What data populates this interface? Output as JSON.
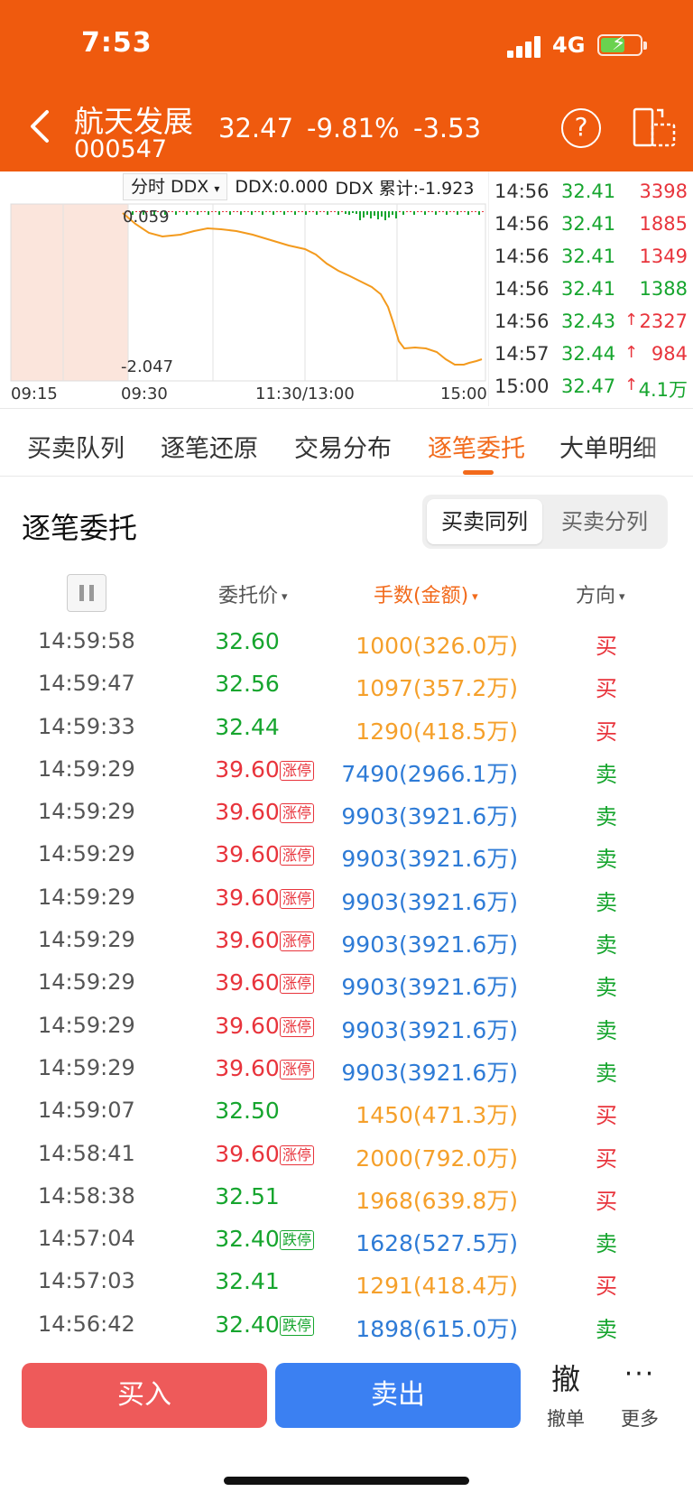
{
  "status_bar": {
    "time": "7:53",
    "network": "4G",
    "battery_bolt": "⚡"
  },
  "header": {
    "name": "航天发展",
    "code": "000547",
    "price": "32.47",
    "change_pct": "-9.81%",
    "change": "-3.53",
    "help_icon": "?"
  },
  "chart": {
    "indicator_select": "分时 DDX",
    "caret": "▾",
    "ddx_value": "DDX:0.000",
    "ddx_cumulative": "DDX 累计:-1.923",
    "top_value": "0.059",
    "bottom_value": "-2.047",
    "x_labels": [
      "09:15",
      "09:30",
      "11:30/13:00",
      "15:00"
    ],
    "line_color": "#f39a1d",
    "premarket_shade": "#fbe5dc"
  },
  "ticks": [
    {
      "time": "14:56",
      "price": "32.41",
      "arrow": "",
      "volume": "3398",
      "price_color": "green",
      "vol_color": "red"
    },
    {
      "time": "14:56",
      "price": "32.41",
      "arrow": "",
      "volume": "1885",
      "price_color": "green",
      "vol_color": "red"
    },
    {
      "time": "14:56",
      "price": "32.41",
      "arrow": "",
      "volume": "1349",
      "price_color": "green",
      "vol_color": "red"
    },
    {
      "time": "14:56",
      "price": "32.41",
      "arrow": "",
      "volume": "1388",
      "price_color": "green",
      "vol_color": "green"
    },
    {
      "time": "14:56",
      "price": "32.43",
      "arrow": "↑",
      "volume": "2327",
      "price_color": "green",
      "vol_color": "red"
    },
    {
      "time": "14:57",
      "price": "32.44",
      "arrow": "↑",
      "volume": "984",
      "price_color": "green",
      "vol_color": "red"
    },
    {
      "time": "15:00",
      "price": "32.47",
      "arrow": "↑",
      "volume": "4.1万",
      "price_color": "green",
      "vol_color": "green"
    }
  ],
  "tabs": [
    {
      "label": "买卖队列",
      "active": false
    },
    {
      "label": "逐笔还原",
      "active": false
    },
    {
      "label": "交易分布",
      "active": false
    },
    {
      "label": "逐笔委托",
      "active": true
    },
    {
      "label": "大单明细",
      "active": false
    }
  ],
  "section": {
    "title": "逐笔委托",
    "segments": [
      {
        "label": "买卖同列",
        "on": true
      },
      {
        "label": "买卖分列",
        "on": false
      }
    ]
  },
  "columns": {
    "price": "委托价",
    "volume": "手数(金额)",
    "direction": "方向",
    "caret": "▾"
  },
  "orders": [
    {
      "time": "14:59:58",
      "price": "32.60",
      "badge": "",
      "volume": "1000(326.0万)",
      "direction": "买",
      "price_color": "green",
      "vol_color": "orange",
      "dir_color": "red"
    },
    {
      "time": "14:59:47",
      "price": "32.56",
      "badge": "",
      "volume": "1097(357.2万)",
      "direction": "买",
      "price_color": "green",
      "vol_color": "orange",
      "dir_color": "red"
    },
    {
      "time": "14:59:33",
      "price": "32.44",
      "badge": "",
      "volume": "1290(418.5万)",
      "direction": "买",
      "price_color": "green",
      "vol_color": "orange",
      "dir_color": "red"
    },
    {
      "time": "14:59:29",
      "price": "39.60",
      "badge": "涨停",
      "badge_type": "up",
      "volume": "7490(2966.1万)",
      "direction": "卖",
      "price_color": "red",
      "vol_color": "blue",
      "dir_color": "green"
    },
    {
      "time": "14:59:29",
      "price": "39.60",
      "badge": "涨停",
      "badge_type": "up",
      "volume": "9903(3921.6万)",
      "direction": "卖",
      "price_color": "red",
      "vol_color": "blue",
      "dir_color": "green"
    },
    {
      "time": "14:59:29",
      "price": "39.60",
      "badge": "涨停",
      "badge_type": "up",
      "volume": "9903(3921.6万)",
      "direction": "卖",
      "price_color": "red",
      "vol_color": "blue",
      "dir_color": "green"
    },
    {
      "time": "14:59:29",
      "price": "39.60",
      "badge": "涨停",
      "badge_type": "up",
      "volume": "9903(3921.6万)",
      "direction": "卖",
      "price_color": "red",
      "vol_color": "blue",
      "dir_color": "green"
    },
    {
      "time": "14:59:29",
      "price": "39.60",
      "badge": "涨停",
      "badge_type": "up",
      "volume": "9903(3921.6万)",
      "direction": "卖",
      "price_color": "red",
      "vol_color": "blue",
      "dir_color": "green"
    },
    {
      "time": "14:59:29",
      "price": "39.60",
      "badge": "涨停",
      "badge_type": "up",
      "volume": "9903(3921.6万)",
      "direction": "卖",
      "price_color": "red",
      "vol_color": "blue",
      "dir_color": "green"
    },
    {
      "time": "14:59:29",
      "price": "39.60",
      "badge": "涨停",
      "badge_type": "up",
      "volume": "9903(3921.6万)",
      "direction": "卖",
      "price_color": "red",
      "vol_color": "blue",
      "dir_color": "green"
    },
    {
      "time": "14:59:29",
      "price": "39.60",
      "badge": "涨停",
      "badge_type": "up",
      "volume": "9903(3921.6万)",
      "direction": "卖",
      "price_color": "red",
      "vol_color": "blue",
      "dir_color": "green"
    },
    {
      "time": "14:59:07",
      "price": "32.50",
      "badge": "",
      "volume": "1450(471.3万)",
      "direction": "买",
      "price_color": "green",
      "vol_color": "orange",
      "dir_color": "red"
    },
    {
      "time": "14:58:41",
      "price": "39.60",
      "badge": "涨停",
      "badge_type": "up",
      "volume": "2000(792.0万)",
      "direction": "买",
      "price_color": "red",
      "vol_color": "orange",
      "dir_color": "red"
    },
    {
      "time": "14:58:38",
      "price": "32.51",
      "badge": "",
      "volume": "1968(639.8万)",
      "direction": "买",
      "price_color": "green",
      "vol_color": "orange",
      "dir_color": "red"
    },
    {
      "time": "14:57:04",
      "price": "32.40",
      "badge": "跌停",
      "badge_type": "down",
      "volume": "1628(527.5万)",
      "direction": "卖",
      "price_color": "green",
      "vol_color": "blue",
      "dir_color": "green"
    },
    {
      "time": "14:57:03",
      "price": "32.41",
      "badge": "",
      "volume": "1291(418.4万)",
      "direction": "买",
      "price_color": "green",
      "vol_color": "orange",
      "dir_color": "red"
    },
    {
      "time": "14:56:42",
      "price": "32.40",
      "badge": "跌停",
      "badge_type": "down",
      "volume": "1898(615.0万)",
      "direction": "卖",
      "price_color": "green",
      "vol_color": "blue",
      "dir_color": "green"
    }
  ],
  "bottom_bar": {
    "buy_label": "买入",
    "sell_label": "卖出",
    "cancel_glyph": "撤",
    "cancel_label": "撤单",
    "more_glyph": "···",
    "more_label": "更多"
  }
}
